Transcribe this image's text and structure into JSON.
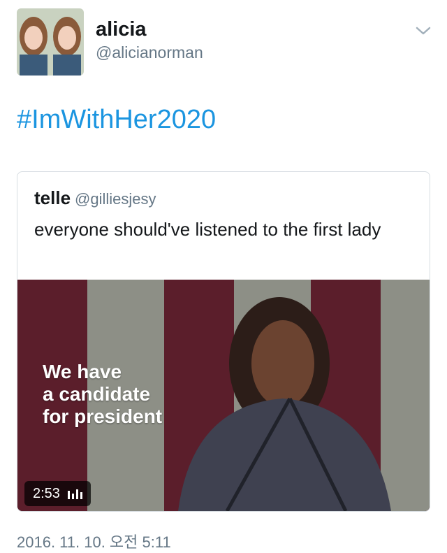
{
  "tweet": {
    "author_name": "alicia",
    "author_handle": "@alicianorman",
    "text": "#ImWithHer2020",
    "timestamp": "2016. 11. 10. 오전 5:11"
  },
  "quoted": {
    "author_name": "telle",
    "author_handle": "@gilliesjesy",
    "text": "everyone should've listened to the first lady",
    "video_caption_lines": [
      "We have",
      "a candidate",
      "for president"
    ],
    "video_duration": "2:53"
  },
  "icons": {
    "menu": "chevron-down-icon",
    "video_indicator": "audio-bars-icon"
  },
  "colors": {
    "link": "#1b95e0",
    "secondary_text": "#657786",
    "border": "#d7dde2"
  }
}
